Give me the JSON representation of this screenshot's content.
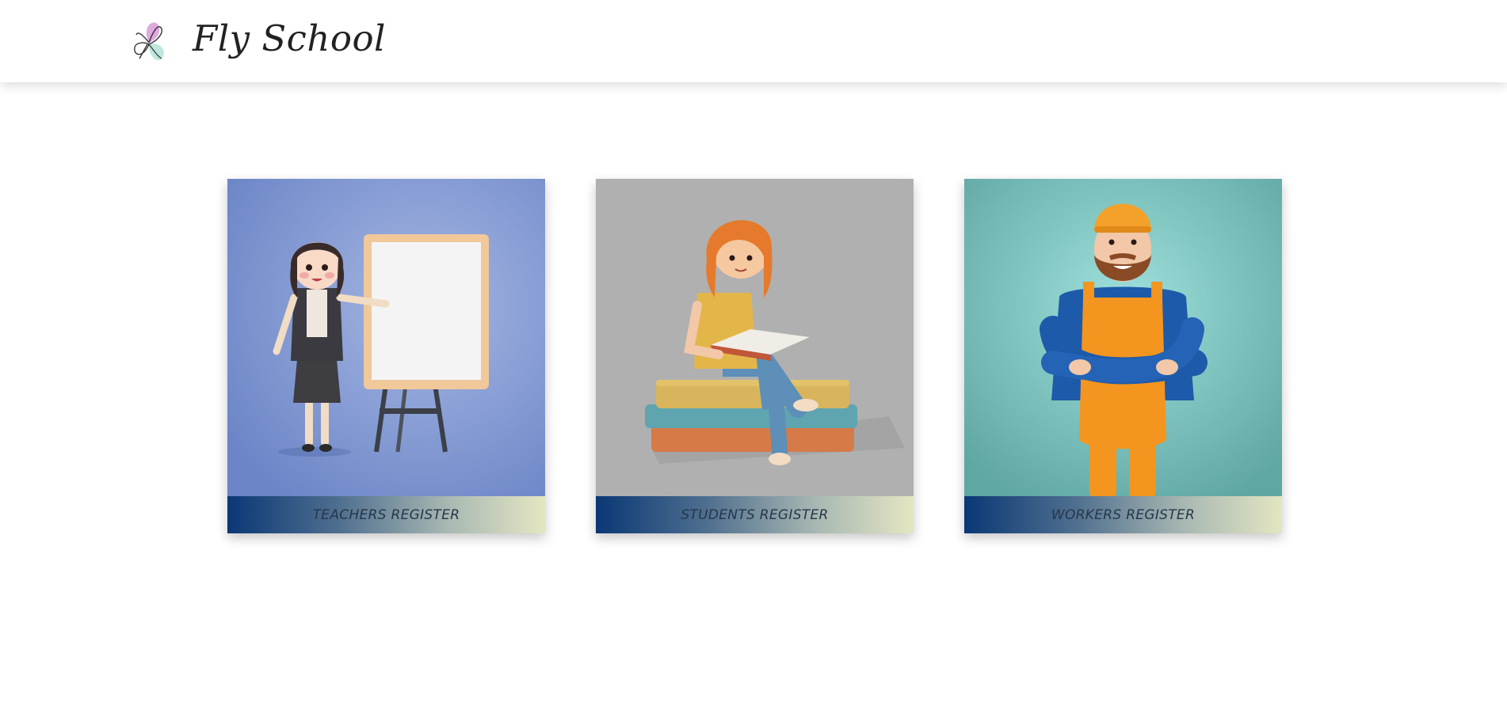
{
  "header": {
    "brand": "Fly School",
    "logo_icon": "butterfly-icon"
  },
  "cards": [
    {
      "label": "TEACHERS REGISTER",
      "illustration": "teacher-whiteboard-icon",
      "bg": "#8ea2d6"
    },
    {
      "label": "STUDENTS REGISTER",
      "illustration": "student-reading-icon",
      "bg": "#b0b0b0"
    },
    {
      "label": "WORKERS REGISTER",
      "illustration": "worker-overalls-icon",
      "bg": "#6bb9b4"
    }
  ],
  "colors": {
    "footer_gradient_start": "#0a3875",
    "footer_gradient_end": "#e4e6c2",
    "label_text": "#26374a"
  }
}
